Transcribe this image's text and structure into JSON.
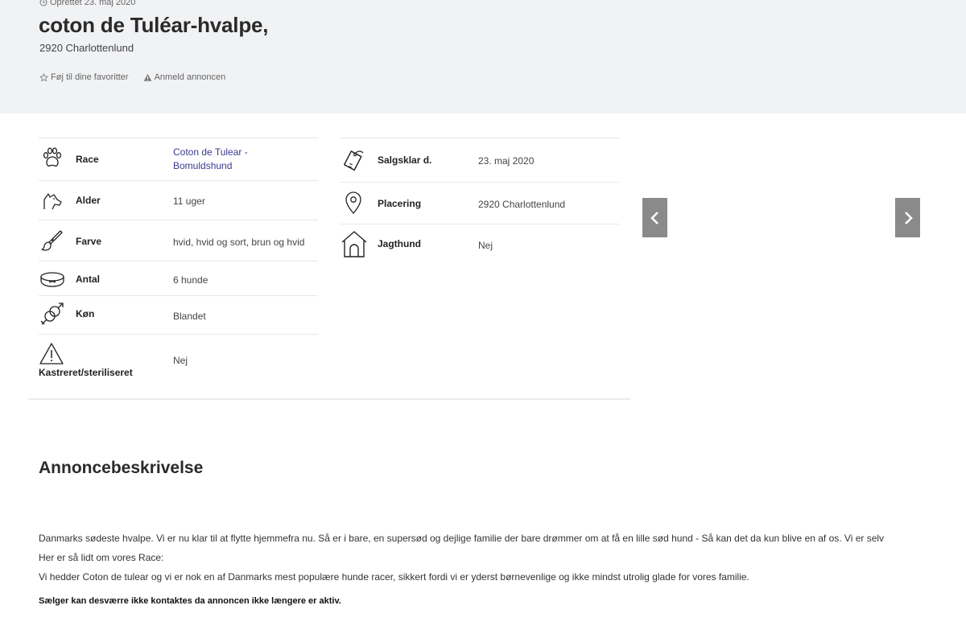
{
  "header": {
    "created": "Oprettet 23. maj 2020",
    "title": "coton de Tuléar-hvalpe,",
    "location": "2920 Charlottenlund",
    "favorite_label": "Føj til dine favoritter",
    "report_label": "Anmeld annoncen"
  },
  "attributes_left": [
    {
      "icon": "paw-icon",
      "label": "Race",
      "value": "Coton de Tulear - Bomuldshund"
    },
    {
      "icon": "dog-head-icon",
      "label": "Alder",
      "value": "11 uger"
    },
    {
      "icon": "brush-icon",
      "label": "Farve",
      "value": "hvid, hvid og sort, brun og hvid"
    },
    {
      "icon": "bowl-icon",
      "label": "Antal",
      "value": "6 hunde"
    },
    {
      "icon": "gender-icon",
      "label": "Køn",
      "value": "Blandet"
    },
    {
      "icon": "warning-icon",
      "label": "Kastreret/steriliseret",
      "value": "Nej"
    }
  ],
  "attributes_right": [
    {
      "icon": "dog-tag-icon",
      "label": "Salgsklar d.",
      "value": "23. maj 2020"
    },
    {
      "icon": "location-pin-icon",
      "label": "Placering",
      "value": "2920 Charlottenlund"
    },
    {
      "icon": "doghouse-icon",
      "label": "Jagthund",
      "value": "Nej"
    }
  ],
  "description": {
    "title": "Annoncebeskrivelse",
    "lines": [
      "Danmarks sødeste hvalpe. Vi er nu klar til at flytte hjemmefra nu. Så er i bare, en supersød og dejlige familie der bare drømmer om at få en lille sød hund - Så kan det da kun blive en af os. Vi er selv",
      "Her er så lidt om vores Race:",
      "Vi hedder Coton de tulear og vi er nok en af Danmarks mest populære hunde racer, sikkert fordi vi er yderst børnevenlige og ikke mindst utrolig glade for vores familie."
    ],
    "notice": "Sælger kan desværre ikke kontaktes da annoncen ikke længere er aktiv."
  },
  "colors": {
    "header_bg": "#f1f2f4",
    "link": "#3a3a8c",
    "gallery_button": "#8a8a8a"
  }
}
